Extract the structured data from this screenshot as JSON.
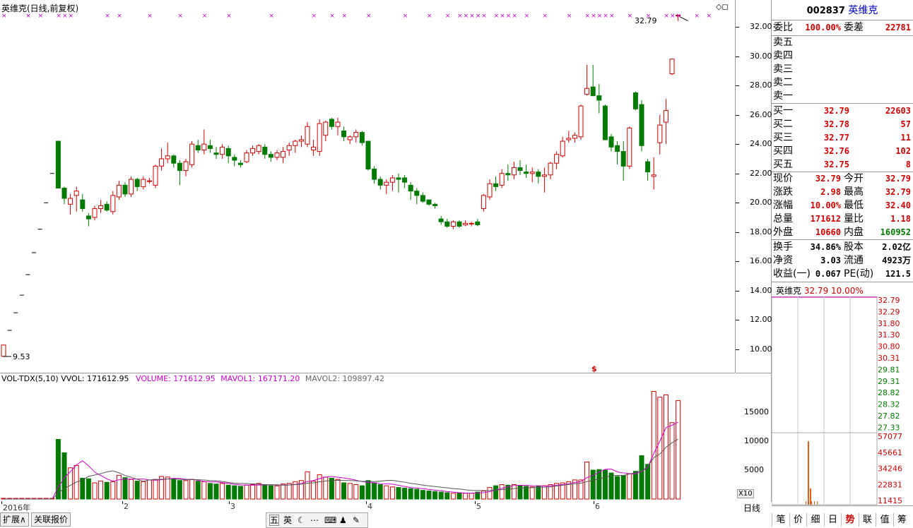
{
  "header": {
    "title": "英维克(日线,前复权)",
    "max_label": "32.79",
    "min_label": "9.53"
  },
  "price_axis": [
    "32.00",
    "30.00",
    "28.00",
    "26.00",
    "24.00",
    "22.00",
    "20.00",
    "18.00",
    "16.00",
    "14.00",
    "12.00",
    "10.00"
  ],
  "volume_header": {
    "indicator": "VOL-TDX(5,10)",
    "vvol": "VVOL: 171612.95",
    "volume": "VOLUME: 171612.95",
    "mavol1": "MAVOL1: 167171.20",
    "mavol2": "MAVOL2: 109897.42"
  },
  "volume_axis": [
    "15000",
    "10000",
    "5000"
  ],
  "volume_unit": "X10",
  "time_axis": [
    "2016年",
    "2",
    "3",
    "4",
    "5",
    "6"
  ],
  "period_label": "日线",
  "bottom_tabs": [
    "扩展∧",
    "关联报价"
  ],
  "toolbar_icons": [
    "五",
    "英"
  ],
  "quote": {
    "code": "002837",
    "name": "英维克",
    "weibi_label": "委比",
    "weibi": "100.00%",
    "weicha_label": "委差",
    "weicha": "22781",
    "sell": [
      {
        "label": "卖五",
        "price": "",
        "vol": ""
      },
      {
        "label": "卖四",
        "price": "",
        "vol": ""
      },
      {
        "label": "卖三",
        "price": "",
        "vol": ""
      },
      {
        "label": "卖二",
        "price": "",
        "vol": ""
      },
      {
        "label": "卖一",
        "price": "",
        "vol": ""
      }
    ],
    "buy": [
      {
        "label": "买一",
        "price": "32.79",
        "vol": "22603"
      },
      {
        "label": "买二",
        "price": "32.78",
        "vol": "57"
      },
      {
        "label": "买三",
        "price": "32.77",
        "vol": "11"
      },
      {
        "label": "买四",
        "price": "32.76",
        "vol": "102"
      },
      {
        "label": "买五",
        "price": "32.75",
        "vol": "8"
      }
    ],
    "stats1": [
      {
        "l1": "现价",
        "v1": "32.79",
        "c1": "red",
        "l2": "今开",
        "v2": "32.79",
        "c2": "red"
      },
      {
        "l1": "涨跌",
        "v1": "2.98",
        "c1": "red",
        "l2": "最高",
        "v2": "32.79",
        "c2": "red"
      },
      {
        "l1": "涨幅",
        "v1": "10.00%",
        "c1": "red",
        "l2": "最低",
        "v2": "32.40",
        "c2": "red"
      },
      {
        "l1": "总量",
        "v1": "171612",
        "c1": "red",
        "l2": "量比",
        "v2": "1.18",
        "c2": "red"
      },
      {
        "l1": "外盘",
        "v1": "10660",
        "c1": "red",
        "l2": "内盘",
        "v2": "160952",
        "c2": "green"
      }
    ],
    "stats2": [
      {
        "l1": "换手",
        "v1": "34.86%",
        "l2": "股本",
        "v2": "2.02亿"
      },
      {
        "l1": "净资",
        "v1": "3.03",
        "l2": "流通",
        "v2": "4923万"
      },
      {
        "l1": "收益(一)",
        "v1": "0.067",
        "l2": "PE(动)",
        "v2": "121.5"
      }
    ]
  },
  "mini_chart": {
    "name": "英维克",
    "price": "32.79",
    "pct": "10.00%",
    "price_scale": [
      "32.79",
      "32.29",
      "31.80",
      "31.30",
      "30.80",
      "30.31",
      "29.81",
      "29.31",
      "28.82",
      "28.32",
      "27.82",
      "27.33"
    ],
    "vol_scale": [
      "57077",
      "45661",
      "34246",
      "22831",
      "11415"
    ]
  },
  "right_tabs": [
    "笔",
    "价",
    "细",
    "日",
    "势",
    "联",
    "值",
    "筹"
  ],
  "chart_data": {
    "type": "candlestick",
    "title": "英维克(日线,前复权)",
    "ylim": [
      9.0,
      33.0
    ],
    "candles": [
      [
        9.53,
        10.3,
        9.53,
        10.3
      ],
      [
        11.3,
        11.3,
        11.3,
        11.3
      ],
      [
        12.5,
        12.5,
        12.5,
        12.5
      ],
      [
        13.7,
        13.7,
        13.7,
        13.7
      ],
      [
        15.1,
        15.1,
        15.1,
        15.1
      ],
      [
        16.6,
        16.6,
        16.6,
        16.6
      ],
      [
        18.2,
        18.2,
        18.2,
        18.2
      ],
      [
        20.0,
        20.0,
        20.0,
        20.0
      ],
      [
        22.0,
        22.0,
        22.0,
        22.0
      ],
      [
        24.2,
        24.2,
        21.1,
        21.0
      ],
      [
        21.0,
        21.1,
        19.9,
        20.3
      ],
      [
        19.9,
        20.6,
        19.2,
        20.3
      ],
      [
        20.5,
        21.1,
        19.4,
        20.8
      ],
      [
        20.2,
        20.6,
        19.4,
        19.6
      ],
      [
        19.1,
        19.3,
        18.4,
        18.9
      ],
      [
        19.0,
        19.8,
        18.8,
        19.6
      ],
      [
        19.6,
        20.2,
        19.3,
        19.8
      ],
      [
        19.9,
        20.1,
        19.4,
        19.5
      ],
      [
        19.4,
        20.8,
        19.2,
        20.5
      ],
      [
        20.4,
        21.5,
        20.2,
        21.2
      ],
      [
        21.2,
        21.4,
        20.4,
        20.6
      ],
      [
        20.6,
        21.8,
        20.4,
        21.6
      ],
      [
        21.6,
        21.7,
        20.8,
        21.1
      ],
      [
        21.1,
        21.8,
        20.9,
        21.6
      ],
      [
        21.5,
        21.7,
        21.3,
        21.5
      ],
      [
        21.2,
        22.6,
        21.0,
        22.5
      ],
      [
        22.5,
        23.7,
        22.2,
        23.0
      ],
      [
        23.0,
        24.1,
        22.7,
        23.2
      ],
      [
        23.2,
        23.3,
        22.4,
        22.7
      ],
      [
        22.7,
        22.9,
        21.2,
        22.2
      ],
      [
        22.2,
        23.0,
        21.8,
        22.8
      ],
      [
        22.6,
        24.2,
        22.4,
        24.0
      ],
      [
        23.9,
        24.3,
        23.4,
        23.6
      ],
      [
        23.6,
        25.0,
        23.3,
        24.0
      ],
      [
        23.9,
        24.3,
        23.4,
        23.7
      ],
      [
        23.4,
        23.8,
        23.0,
        23.3
      ],
      [
        23.3,
        24.0,
        23.0,
        23.8
      ],
      [
        23.7,
        23.9,
        22.7,
        23.2
      ],
      [
        23.1,
        23.3,
        22.5,
        22.9
      ],
      [
        22.7,
        22.9,
        22.4,
        22.6
      ],
      [
        22.8,
        23.6,
        22.7,
        23.4
      ],
      [
        23.4,
        23.9,
        23.2,
        23.7
      ],
      [
        23.5,
        24.0,
        23.3,
        23.9
      ],
      [
        23.8,
        24.0,
        23.0,
        23.3
      ],
      [
        23.3,
        23.5,
        22.8,
        23.1
      ],
      [
        23.1,
        23.6,
        22.9,
        23.4
      ],
      [
        23.1,
        23.8,
        22.7,
        23.5
      ],
      [
        23.6,
        24.1,
        23.2,
        23.9
      ],
      [
        23.9,
        24.3,
        23.4,
        24.2
      ],
      [
        24.2,
        24.6,
        23.8,
        24.3
      ],
      [
        24.0,
        25.5,
        23.8,
        25.2
      ],
      [
        23.6,
        24.3,
        23.2,
        23.8
      ],
      [
        23.5,
        25.7,
        23.2,
        25.4
      ],
      [
        24.6,
        25.6,
        24.2,
        25.5
      ],
      [
        25.7,
        25.8,
        25.0,
        25.2
      ],
      [
        25.2,
        25.8,
        24.6,
        25.5
      ],
      [
        24.9,
        25.2,
        24.2,
        24.5
      ],
      [
        24.3,
        24.6,
        24.0,
        24.5
      ],
      [
        24.5,
        25.0,
        24.1,
        24.8
      ],
      [
        24.8,
        24.9,
        23.9,
        24.1
      ],
      [
        24.2,
        24.2,
        22.2,
        22.3
      ],
      [
        22.3,
        22.5,
        21.3,
        21.6
      ],
      [
        21.6,
        21.8,
        20.9,
        21.2
      ],
      [
        21.2,
        21.6,
        20.6,
        21.4
      ],
      [
        21.4,
        21.9,
        20.8,
        21.7
      ],
      [
        21.7,
        22.0,
        20.7,
        21.6
      ],
      [
        21.7,
        21.9,
        21.0,
        21.4
      ],
      [
        21.2,
        21.4,
        20.2,
        20.8
      ],
      [
        20.8,
        21.0,
        19.9,
        20.5
      ],
      [
        20.5,
        20.7,
        20.0,
        20.1
      ],
      [
        20.2,
        20.2,
        19.8,
        19.9
      ],
      [
        19.9,
        20.0,
        19.6,
        19.8
      ],
      [
        18.9,
        19.1,
        18.5,
        18.7
      ],
      [
        18.7,
        18.9,
        18.3,
        18.4
      ],
      [
        18.4,
        18.8,
        18.2,
        18.7
      ],
      [
        18.7,
        18.8,
        18.3,
        18.4
      ],
      [
        18.5,
        18.8,
        18.4,
        18.6
      ],
      [
        18.6,
        18.7,
        18.4,
        18.6
      ],
      [
        18.7,
        18.9,
        18.4,
        18.5
      ],
      [
        19.6,
        20.6,
        19.4,
        20.5
      ],
      [
        20.4,
        21.6,
        20.2,
        21.3
      ],
      [
        21.3,
        21.8,
        20.8,
        21.1
      ],
      [
        21.2,
        22.3,
        21.0,
        22.0
      ],
      [
        22.0,
        22.6,
        21.5,
        21.9
      ],
      [
        21.9,
        22.8,
        21.6,
        22.4
      ],
      [
        22.4,
        22.9,
        21.9,
        22.2
      ],
      [
        22.1,
        22.6,
        21.7,
        22.0
      ],
      [
        22.0,
        22.4,
        21.4,
        22.1
      ],
      [
        22.1,
        22.3,
        21.3,
        21.8
      ],
      [
        21.8,
        22.4,
        20.7,
        21.9
      ],
      [
        21.9,
        22.8,
        21.6,
        22.7
      ],
      [
        22.7,
        23.5,
        22.3,
        23.3
      ],
      [
        23.2,
        24.5,
        23.1,
        24.2
      ],
      [
        24.3,
        24.9,
        24.1,
        24.4
      ],
      [
        24.4,
        24.8,
        24.1,
        24.6
      ],
      [
        24.5,
        26.7,
        24.3,
        26.6
      ],
      [
        27.4,
        29.4,
        27.3,
        27.8
      ],
      [
        27.9,
        29.4,
        27.3,
        27.3
      ],
      [
        27.3,
        28.1,
        26.1,
        27.0
      ],
      [
        26.6,
        26.7,
        24.3,
        24.3
      ],
      [
        24.5,
        24.7,
        23.5,
        23.8
      ],
      [
        23.9,
        24.2,
        22.6,
        23.5
      ],
      [
        23.5,
        24.2,
        21.5,
        22.5
      ],
      [
        22.5,
        25.2,
        22.3,
        25.1
      ],
      [
        27.5,
        27.6,
        26.3,
        26.4
      ],
      [
        26.7,
        27.0,
        23.5,
        23.9
      ],
      [
        22.8,
        23.0,
        21.5,
        22.1
      ],
      [
        21.8,
        23.1,
        20.9,
        21.9
      ],
      [
        24.1,
        26.0,
        23.3,
        25.3
      ],
      [
        25.5,
        27.1,
        24.0,
        26.3
      ],
      [
        28.8,
        29.8,
        28.7,
        29.8
      ],
      [
        32.79,
        32.79,
        32.4,
        32.79
      ]
    ],
    "volumes": [
      0,
      0,
      0,
      0,
      0,
      0,
      0,
      0,
      0,
      10300,
      8000,
      5400,
      5800,
      3600,
      3500,
      2800,
      3100,
      2900,
      3000,
      4100,
      3700,
      3400,
      3100,
      3000,
      3300,
      3400,
      3900,
      3800,
      3500,
      3200,
      3200,
      3400,
      3100,
      3000,
      2700,
      2600,
      2700,
      2400,
      2300,
      2200,
      2400,
      2500,
      2700,
      2500,
      2300,
      2300,
      2600,
      2700,
      3000,
      3200,
      4700,
      3100,
      4200,
      3800,
      3600,
      3400,
      2800,
      2700,
      2500,
      2300,
      3200,
      2800,
      2500,
      2300,
      2100,
      2000,
      1900,
      1800,
      1700,
      1500,
      1400,
      1300,
      1200,
      1100,
      1000,
      1100,
      1000,
      1000,
      1200,
      1400,
      2000,
      2300,
      2500,
      2400,
      2500,
      2300,
      2200,
      2100,
      2300,
      2300,
      2500,
      2700,
      2800,
      3000,
      3300,
      3300,
      6400,
      5000,
      5100,
      5000,
      4500,
      3900,
      4100,
      4400,
      4800,
      7500,
      6000,
      18600,
      17600,
      18000,
      13200,
      17000
    ],
    "vol_ylim": [
      0,
      20000
    ],
    "mavol1": [
      0,
      0,
      0,
      0,
      0,
      0,
      0,
      0,
      0,
      2060,
      3660,
      4740,
      5900,
      6620,
      5740,
      4660,
      4060,
      3480,
      3100,
      3320,
      3460,
      3460,
      3460,
      3460,
      3300,
      3260,
      3340,
      3480,
      3580,
      3560,
      3420,
      3400,
      3240,
      3040,
      2980,
      2960,
      2840,
      2700,
      2540,
      2440,
      2420,
      2400,
      2420,
      2460,
      2480,
      2460,
      2420,
      2440,
      2540,
      2680,
      3040,
      3200,
      3520,
      3800,
      3880,
      3760,
      3660,
      3480,
      3260,
      3020,
      2900,
      2800,
      2660,
      2620,
      2580,
      2380,
      2180,
      1980,
      1900,
      1800,
      1660,
      1540,
      1420,
      1300,
      1200,
      1100,
      1040,
      1020,
      1060,
      1120,
      1300,
      1560,
      1840,
      2120,
      2340,
      2400,
      2360,
      2300,
      2280,
      2240,
      2280,
      2380,
      2520,
      2660,
      2860,
      3020,
      3720,
      4080,
      4620,
      5160,
      5200,
      4700,
      4520,
      4380,
      4340,
      4780,
      5460,
      7900,
      10000,
      12340,
      12760,
      13280
    ],
    "mavol2": [
      0,
      0,
      0,
      0,
      0,
      0,
      0,
      0,
      0,
      1030,
      1830,
      2370,
      2950,
      3310,
      3930,
      4140,
      4400,
      4700,
      4870,
      4530,
      4060,
      3770,
      3410,
      3050,
      3310,
      3360,
      3410,
      3470,
      3440,
      3410,
      3340,
      3370,
      3340,
      3300,
      3190,
      3160,
      3040,
      2870,
      2740,
      2690,
      2690,
      2620,
      2560,
      2500,
      2460,
      2430,
      2410,
      2430,
      2500,
      2570,
      2750,
      2810,
      2970,
      3120,
      3180,
      3250,
      3220,
      3200,
      3160,
      3050,
      3070,
      3010,
      3090,
      3210,
      3230,
      3070,
      2920,
      2720,
      2580,
      2410,
      2280,
      2170,
      2040,
      1940,
      1800,
      1740,
      1600,
      1500,
      1480,
      1460,
      1480,
      1550,
      1630,
      1710,
      1820,
      1890,
      1930,
      1960,
      2030,
      2060,
      2120,
      2250,
      2400,
      2520,
      2650,
      2730,
      3040,
      3230,
      3480,
      3780,
      4030,
      4080,
      4090,
      4320,
      4600,
      4850,
      5580,
      7170,
      7770,
      8950,
      9730,
      10340
    ],
    "markers_x": [
      0,
      4,
      6,
      9,
      10,
      11,
      17,
      19,
      24,
      29,
      33,
      37,
      44,
      51,
      54,
      56,
      60,
      66,
      70,
      73,
      75,
      76,
      77,
      78,
      79,
      81,
      82,
      83,
      84,
      86,
      89,
      93,
      96,
      97,
      98,
      99,
      100,
      103,
      106,
      109,
      110,
      111,
      114,
      116
    ]
  }
}
